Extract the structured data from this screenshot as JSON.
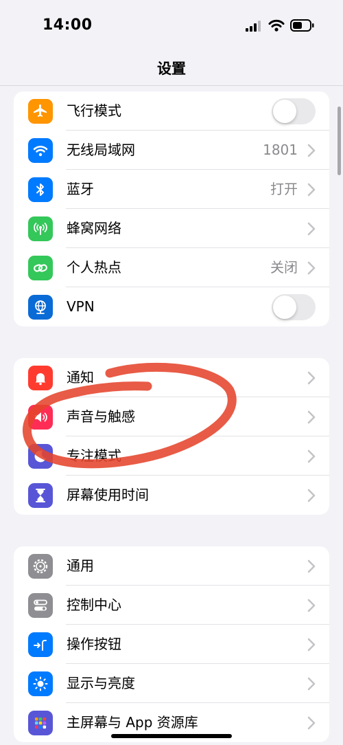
{
  "status_bar": {
    "time": "14:00"
  },
  "nav": {
    "title": "设置"
  },
  "groups": [
    {
      "items": [
        {
          "label": "飞行模式",
          "icon": "airplane-icon",
          "icon_color": "#ff9500",
          "control": "toggle",
          "toggle_on": false
        },
        {
          "label": "无线局域网",
          "icon": "wifi-icon",
          "icon_color": "#007aff",
          "value": "1801",
          "control": "chevron"
        },
        {
          "label": "蓝牙",
          "icon": "bluetooth-icon",
          "icon_color": "#007aff",
          "value": "打开",
          "control": "chevron"
        },
        {
          "label": "蜂窝网络",
          "icon": "cellular-antenna-icon",
          "icon_color": "#34c759",
          "control": "chevron"
        },
        {
          "label": "个人热点",
          "icon": "hotspot-chain-icon",
          "icon_color": "#34c759",
          "value": "关闭",
          "control": "chevron"
        },
        {
          "label": "VPN",
          "icon": "vpn-globe-icon",
          "icon_color": "#0a6bd6",
          "control": "toggle",
          "toggle_on": false
        }
      ]
    },
    {
      "items": [
        {
          "label": "通知",
          "icon": "bell-icon",
          "icon_color": "#ff3b30",
          "control": "chevron"
        },
        {
          "label": "声音与触感",
          "icon": "speaker-icon",
          "icon_color": "#ff2d55",
          "control": "chevron"
        },
        {
          "label": "专注模式",
          "icon": "moon-icon",
          "icon_color": "#5856d6",
          "control": "chevron"
        },
        {
          "label": "屏幕使用时间",
          "icon": "hourglass-icon",
          "icon_color": "#5856d6",
          "control": "chevron"
        }
      ]
    },
    {
      "items": [
        {
          "label": "通用",
          "icon": "gear-icon",
          "icon_color": "#8e8e93",
          "control": "chevron"
        },
        {
          "label": "控制中心",
          "icon": "control-switches-icon",
          "icon_color": "#8e8e93",
          "control": "chevron"
        },
        {
          "label": "操作按钮",
          "icon": "action-button-icon",
          "icon_color": "#007aff",
          "control": "chevron"
        },
        {
          "label": "显示与亮度",
          "icon": "sun-icon",
          "icon_color": "#007aff",
          "control": "chevron"
        },
        {
          "label": "主屏幕与 App 资源库",
          "icon": "app-grid-icon",
          "icon_color": "#5856d6",
          "control": "chevron"
        }
      ]
    }
  ],
  "annotation": {
    "color": "#e5442c"
  }
}
